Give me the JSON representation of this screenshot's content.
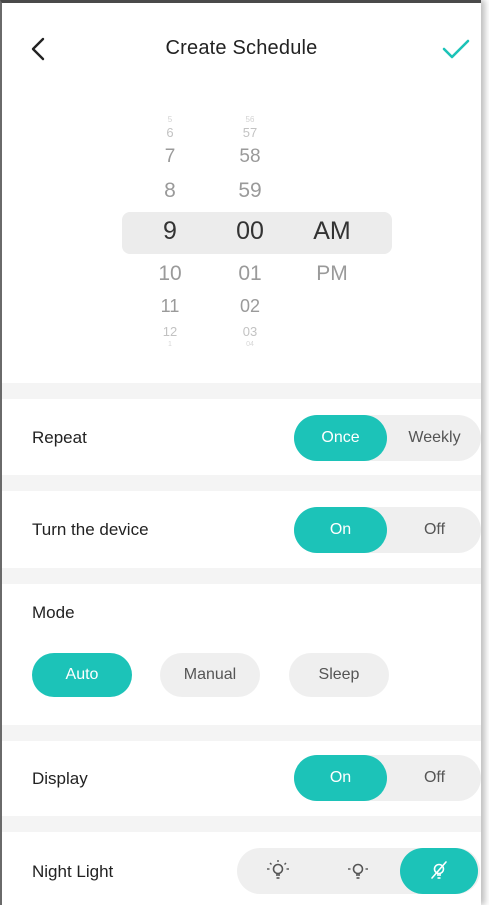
{
  "header": {
    "title": "Create Schedule"
  },
  "picker": {
    "hours": [
      "5",
      "6",
      "7",
      "8",
      "9",
      "10",
      "11",
      "12",
      "1"
    ],
    "minutes": [
      "56",
      "57",
      "58",
      "59",
      "00",
      "01",
      "02",
      "03",
      "04"
    ],
    "ampm": [
      "AM",
      "PM"
    ],
    "selected": {
      "hour": "9",
      "minute": "00",
      "period": "AM"
    }
  },
  "repeat": {
    "label": "Repeat",
    "options": [
      "Once",
      "Weekly"
    ],
    "selected": "Once"
  },
  "turn_device": {
    "label": "Turn the device",
    "options": [
      "On",
      "Off"
    ],
    "selected": "On"
  },
  "mode": {
    "label": "Mode",
    "options": [
      "Auto",
      "Manual",
      "Sleep"
    ],
    "selected": "Auto"
  },
  "display": {
    "label": "Display",
    "options": [
      "On",
      "Off"
    ],
    "selected": "On"
  },
  "night_light": {
    "label": "Night Light",
    "options": [
      "bulb-bright-icon",
      "bulb-dim-icon",
      "bulb-off-icon"
    ],
    "selected": "bulb-off-icon"
  },
  "colors": {
    "accent": "#1cc3b8",
    "pill_bg": "#efefef",
    "separator": "#f4f4f4"
  }
}
